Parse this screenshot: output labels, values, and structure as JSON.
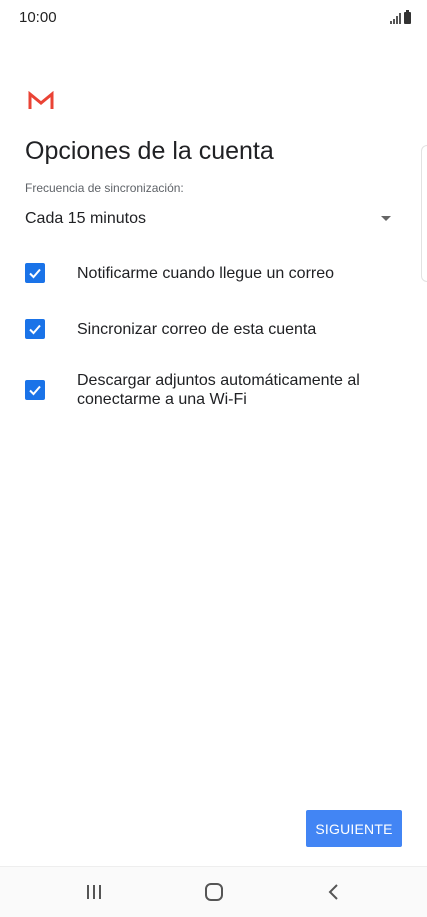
{
  "status_bar": {
    "time": "10:00",
    "icons": [
      "signal-icon",
      "battery-icon"
    ]
  },
  "app": {
    "logo": "gmail-logo",
    "brand_color": "#EA4335"
  },
  "page": {
    "title": "Opciones de la cuenta",
    "sync_label": "Frecuencia de sincronización:",
    "sync_value": "Cada 15 minutos"
  },
  "options": [
    {
      "label": "Notificarme cuando llegue un correo",
      "checked": true
    },
    {
      "label": "Sincronizar correo de esta cuenta",
      "checked": true
    },
    {
      "label": "Descargar adjuntos automáticamente al conectarme a una Wi-Fi",
      "checked": true
    }
  ],
  "actions": {
    "next_label": "SIGUIENTE"
  },
  "colors": {
    "accent": "#1A73E8",
    "button": "#4285F4"
  },
  "nav_bar": {
    "buttons": [
      "recent-apps-icon",
      "home-icon",
      "back-icon"
    ]
  }
}
